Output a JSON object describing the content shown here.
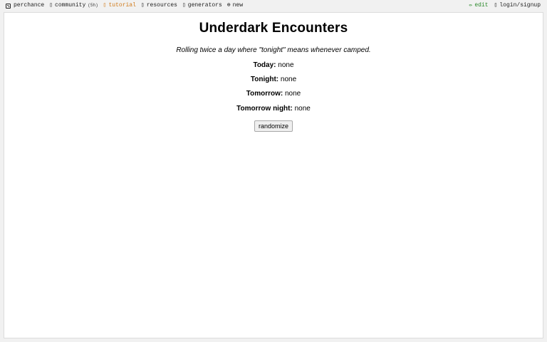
{
  "topbar": {
    "brand": "perchance",
    "community": "community",
    "community_count": "(5h)",
    "tutorial": "tutorial",
    "resources": "resources",
    "generators": "generators",
    "new": "new",
    "edit": "edit",
    "login": "login/signup"
  },
  "page": {
    "title": "Underdark Encounters",
    "subtitle": "Rolling twice a day where \"tonight\" means whenever camped.",
    "rows": [
      {
        "label": "Today:",
        "value": "none"
      },
      {
        "label": "Tonight:",
        "value": "none"
      },
      {
        "label": "Tomorrow:",
        "value": "none"
      },
      {
        "label": "Tomorrow night:",
        "value": "none"
      }
    ],
    "button": "randomize"
  },
  "colors": {
    "tutorial": "#d07a1a",
    "edit": "#2c8a2c"
  }
}
